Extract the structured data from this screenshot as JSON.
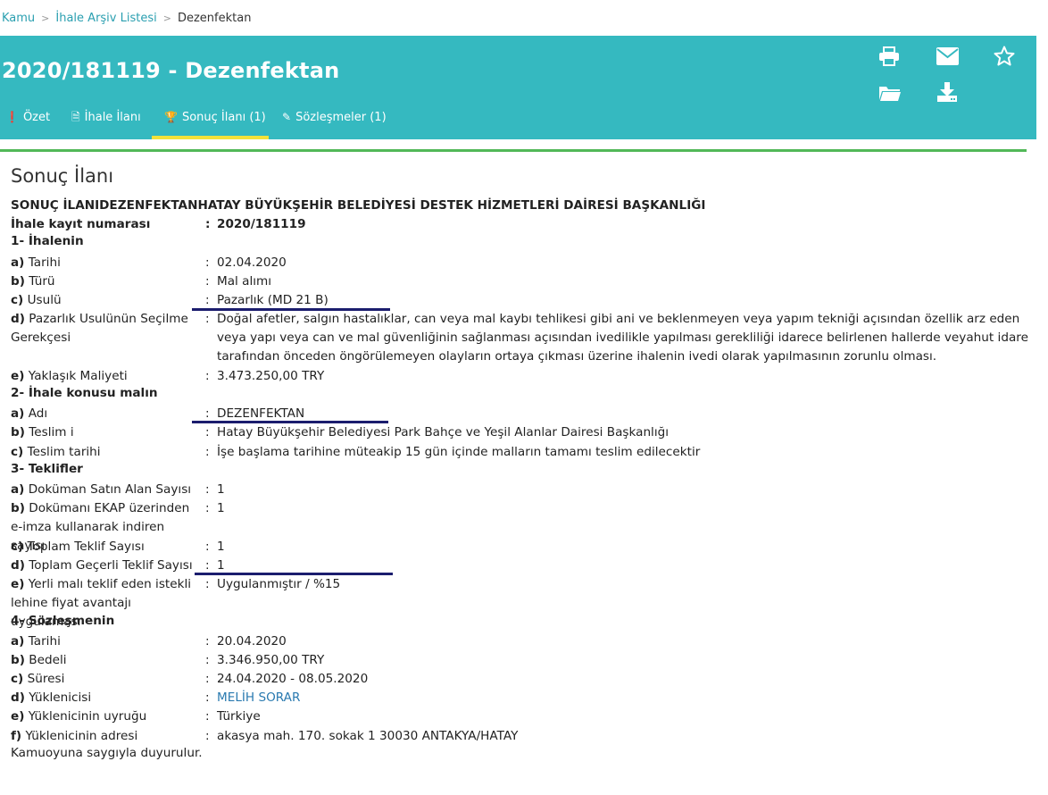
{
  "breadcrumb": {
    "items": [
      "Kamu",
      "İhale Arşiv Listesi",
      "Dezenfektan"
    ]
  },
  "header": {
    "title": "2020/181119 - Dezenfektan",
    "bg_color": "#35b9c0",
    "tabs": [
      {
        "icon": "info-icon",
        "label": "Özet"
      },
      {
        "icon": "document-icon",
        "label": "İhale İlanı"
      },
      {
        "icon": "trophy-icon",
        "label": "Sonuç İlanı (1)",
        "active": true
      },
      {
        "icon": "edit-icon",
        "label": "Sözleşmeler (1)"
      }
    ],
    "actions": [
      "print-icon",
      "mail-icon",
      "star-icon",
      "folder-open-icon",
      "download-icon"
    ]
  },
  "content": {
    "section_title": "Sonuç İlanı",
    "heading": "SONUÇ İLANIDEZENFEKTANHATAY BÜYÜKŞEHİR BELEDİYESİ DESTEK HİZMETLERİ DAİRESİ BAŞKANLIĞI",
    "kayit": {
      "label": "İhale kayıt numarası",
      "value": "2020/181119"
    },
    "s1": {
      "title": "1- İhalenin",
      "a": {
        "key": "a)",
        "label": " Tarihi",
        "value": "02.04.2020"
      },
      "b": {
        "key": "b)",
        "label": " Türü",
        "value": "Mal alımı"
      },
      "c": {
        "key": "c)",
        "label": " Usulü",
        "value": "Pazarlık (MD 21 B)"
      },
      "d": {
        "key": "d)",
        "label": " Pazarlık Usulünün Seçilme Gerekçesi",
        "value": "Doğal afetler, salgın hastalıklar, can veya mal kaybı tehlikesi gibi ani ve beklenmeyen veya yapım tekniği açısından özellik arz eden veya yapı veya can ve mal güvenliğinin sağlanması açısından ivedilikle yapılması gerekliliği idarece belirlenen hallerde veyahut idare tarafından önceden öngörülemeyen olayların ortaya çıkması üzerine ihalenin ivedi olarak yapılmasının zorunlu olması."
      },
      "e": {
        "key": "e)",
        "label": " Yaklaşık Maliyeti",
        "value": "3.473.250,00 TRY"
      }
    },
    "s2": {
      "title": "2- İhale konusu malın",
      "a": {
        "key": "a)",
        "label": " Adı",
        "value": "DEZENFEKTAN"
      },
      "b": {
        "key": "b)",
        "label": " Teslim i",
        "value": "Hatay Büyükşehir Belediyesi Park Bahçe ve Yeşil Alanlar Dairesi Başkanlığı"
      },
      "c": {
        "key": "c)",
        "label": " Teslim tarihi",
        "value": "İşe başlama tarihine müteakip 15 gün içinde malların tamamı teslim edilecektir"
      }
    },
    "s3": {
      "title": "3- Teklifler",
      "a": {
        "key": "a)",
        "label": " Doküman Satın Alan Sayısı",
        "value": "1"
      },
      "b": {
        "key": "b)",
        "label": " Dokümanı EKAP üzerinden e-imza kullanarak indiren sayısı",
        "value": "1"
      },
      "c": {
        "key": "c)",
        "label": " Toplam Teklif Sayısı",
        "value": "1"
      },
      "d": {
        "key": "d)",
        "label": " Toplam Geçerli Teklif Sayısı",
        "value": "1"
      },
      "e": {
        "key": "e)",
        "label": " Yerli malı teklif eden istekli lehine fiyat avantajı uygulaması",
        "value": "Uygulanmıştır / %15"
      }
    },
    "s4": {
      "title": "4- Sözleşmenin",
      "a": {
        "key": "a)",
        "label": " Tarihi",
        "value": "20.04.2020"
      },
      "b": {
        "key": "b)",
        "label": " Bedeli",
        "value": "3.346.950,00 TRY"
      },
      "c": {
        "key": "c)",
        "label": " Süresi",
        "value": "24.04.2020 - 08.05.2020"
      },
      "d": {
        "key": "d)",
        "label": " Yüklenicisi",
        "value": "MELİH SORAR"
      },
      "e": {
        "key": "e)",
        "label": " Yüklenicinin uyruğu",
        "value": "Türkiye"
      },
      "f": {
        "key": "f)",
        "label": " Yüklenicinin adresi",
        "value": "akasya mah. 170. sokak 1 30030 ANTAKYA/HATAY"
      }
    },
    "closing": "Kamuoyuna saygıyla duyurulur.",
    "colon": ":"
  }
}
